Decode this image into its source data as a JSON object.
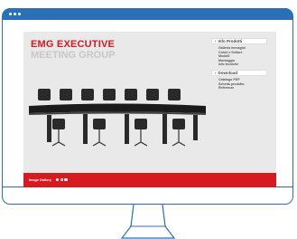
{
  "site": {
    "title": "EMG EXECUTIVE",
    "subtitle": "MEETING GROUP"
  },
  "menu": {
    "section1": {
      "label": "Info Prodotti",
      "items": [
        "Galleria immagini",
        "Colori e finiture",
        "Modelli",
        "Montaggio",
        "Info tecniche"
      ]
    },
    "section2": {
      "label": "Download",
      "items": [
        "Catalogo PDF",
        "Scheda prodotto",
        "Referenze"
      ]
    }
  },
  "footer": {
    "label": "Image Gallery"
  },
  "colors": {
    "accent": "#d71920",
    "frame": "#2b6fb7"
  }
}
